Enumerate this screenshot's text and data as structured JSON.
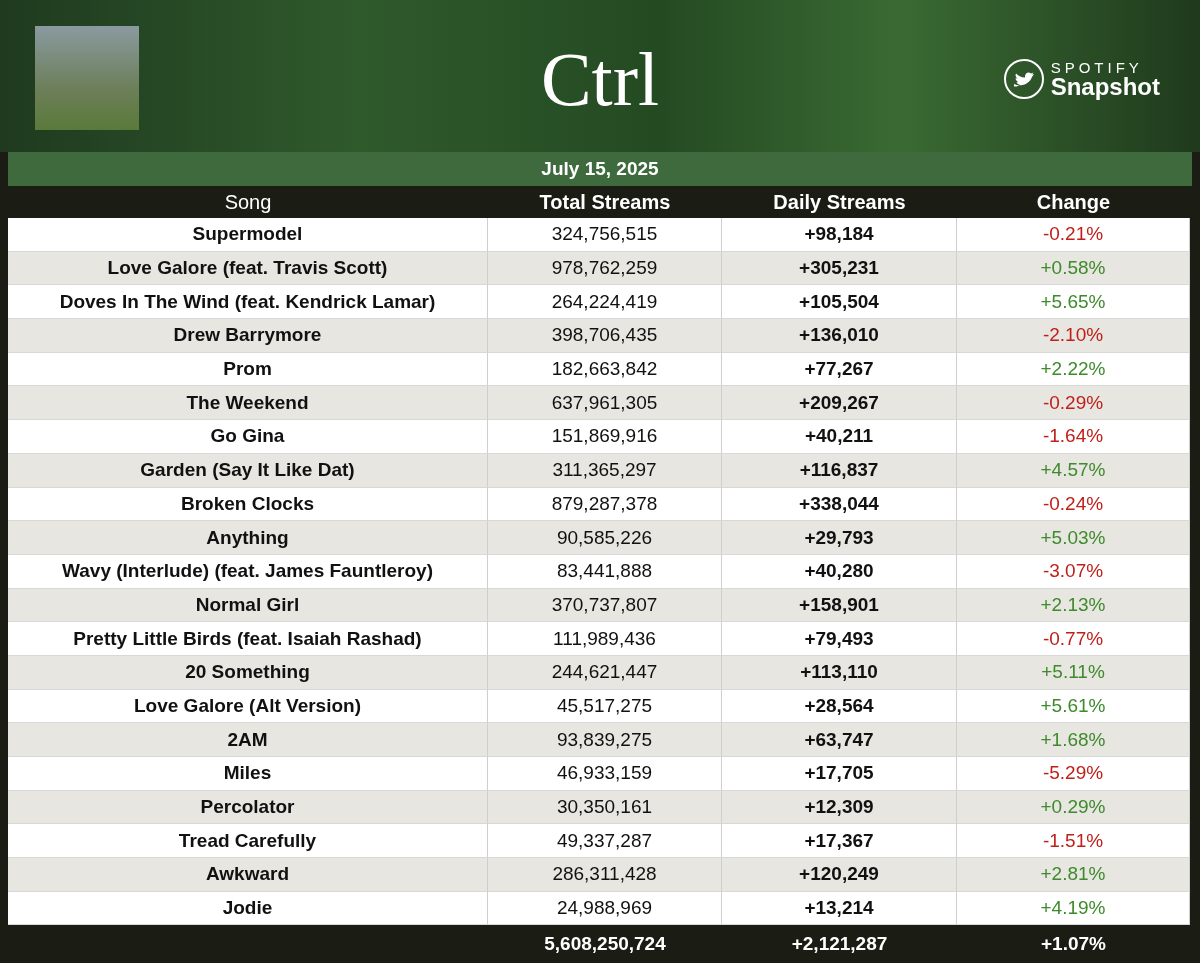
{
  "banner": {
    "title": "Ctrl",
    "brand_top": "SPOTIFY",
    "brand_bottom": "Snapshot"
  },
  "date": "July 15, 2025",
  "columns": [
    "Song",
    "Total Streams",
    "Daily Streams",
    "Change"
  ],
  "rows": [
    {
      "song": "Supermodel",
      "total": "324,756,515",
      "daily": "+98,184",
      "change": "-0.21%",
      "color": "#c0201a"
    },
    {
      "song": "Love Galore (feat. Travis Scott)",
      "total": "978,762,259",
      "daily": "+305,231",
      "change": "+0.58%",
      "color": "#3e8a2c"
    },
    {
      "song": "Doves In The Wind (feat. Kendrick Lamar)",
      "total": "264,224,419",
      "daily": "+105,504",
      "change": "+5.65%",
      "color": "#3e8a2c"
    },
    {
      "song": "Drew Barrymore",
      "total": "398,706,435",
      "daily": "+136,010",
      "change": "-2.10%",
      "color": "#c0201a"
    },
    {
      "song": "Prom",
      "total": "182,663,842",
      "daily": "+77,267",
      "change": "+2.22%",
      "color": "#3e8a2c"
    },
    {
      "song": "The Weekend",
      "total": "637,961,305",
      "daily": "+209,267",
      "change": "-0.29%",
      "color": "#c0201a"
    },
    {
      "song": "Go Gina",
      "total": "151,869,916",
      "daily": "+40,211",
      "change": "-1.64%",
      "color": "#c0201a"
    },
    {
      "song": "Garden (Say It Like Dat)",
      "total": "311,365,297",
      "daily": "+116,837",
      "change": "+4.57%",
      "color": "#3e8a2c"
    },
    {
      "song": "Broken Clocks",
      "total": "879,287,378",
      "daily": "+338,044",
      "change": "-0.24%",
      "color": "#c0201a"
    },
    {
      "song": "Anything",
      "total": "90,585,226",
      "daily": "+29,793",
      "change": "+5.03%",
      "color": "#3e8a2c"
    },
    {
      "song": "Wavy (Interlude) (feat. James Fauntleroy)",
      "total": "83,441,888",
      "daily": "+40,280",
      "change": "-3.07%",
      "color": "#c0201a"
    },
    {
      "song": "Normal Girl",
      "total": "370,737,807",
      "daily": "+158,901",
      "change": "+2.13%",
      "color": "#3e8a2c"
    },
    {
      "song": "Pretty Little Birds (feat. Isaiah Rashad)",
      "total": "111,989,436",
      "daily": "+79,493",
      "change": "-0.77%",
      "color": "#c0201a"
    },
    {
      "song": "20 Something",
      "total": "244,621,447",
      "daily": "+113,110",
      "change": "+5.11%",
      "color": "#3e8a2c"
    },
    {
      "song": "Love Galore (Alt Version)",
      "total": "45,517,275",
      "daily": "+28,564",
      "change": "+5.61%",
      "color": "#3e8a2c"
    },
    {
      "song": "2AM",
      "total": "93,839,275",
      "daily": "+63,747",
      "change": "+1.68%",
      "color": "#3e8a2c"
    },
    {
      "song": "Miles",
      "total": "46,933,159",
      "daily": "+17,705",
      "change": "-5.29%",
      "color": "#c0201a"
    },
    {
      "song": "Percolator",
      "total": "30,350,161",
      "daily": "+12,309",
      "change": "+0.29%",
      "color": "#3e8a2c"
    },
    {
      "song": "Tread Carefully",
      "total": "49,337,287",
      "daily": "+17,367",
      "change": "-1.51%",
      "color": "#c0201a"
    },
    {
      "song": "Awkward",
      "total": "286,311,428",
      "daily": "+120,249",
      "change": "+2.81%",
      "color": "#3e8a2c"
    },
    {
      "song": "Jodie",
      "total": "24,988,969",
      "daily": "+13,214",
      "change": "+4.19%",
      "color": "#3e8a2c"
    }
  ],
  "totals": {
    "total": "5,608,250,724",
    "daily": "+2,121,287",
    "change": "+1.07%"
  }
}
